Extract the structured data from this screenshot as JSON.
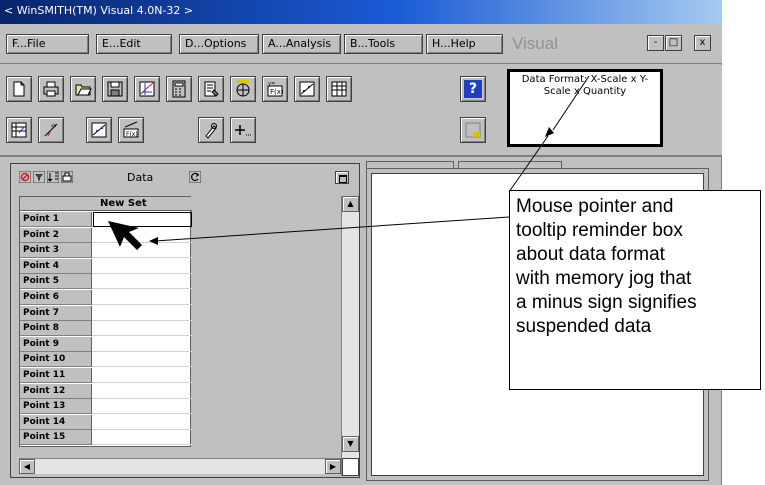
{
  "window": {
    "title": "< WinSMITH(TM) Visual 4.0N-32 >"
  },
  "menu": {
    "items": [
      {
        "label": "F...File"
      },
      {
        "label": "E...Edit"
      },
      {
        "label": "D...Options"
      },
      {
        "label": "A...Analysis"
      },
      {
        "label": "B...Tools"
      },
      {
        "label": "H...Help"
      }
    ],
    "brand": "Visual",
    "minimize": "-",
    "maximize": "□",
    "close": "x"
  },
  "toolbar": {
    "help_label": "?",
    "tooltip_text": "Data Format: X-Scale x Y-Scale x Quantity"
  },
  "data_panel": {
    "title": "Data",
    "column_header": "New Set",
    "rows": [
      {
        "label": "Point 1",
        "value": ""
      },
      {
        "label": "Point 2",
        "value": ""
      },
      {
        "label": "Point 3",
        "value": ""
      },
      {
        "label": "Point 4",
        "value": ""
      },
      {
        "label": "Point 5",
        "value": ""
      },
      {
        "label": "Point 6",
        "value": ""
      },
      {
        "label": "Point 7",
        "value": ""
      },
      {
        "label": "Point 8",
        "value": ""
      },
      {
        "label": "Point 9",
        "value": ""
      },
      {
        "label": "Point 10",
        "value": ""
      },
      {
        "label": "Point 11",
        "value": ""
      },
      {
        "label": "Point 12",
        "value": ""
      },
      {
        "label": "Point 13",
        "value": ""
      },
      {
        "label": "Point 14",
        "value": ""
      },
      {
        "label": "Point 15",
        "value": ""
      }
    ]
  },
  "callout": {
    "lines": [
      "Mouse pointer and",
      "tooltip reminder box",
      "about data format",
      "with memory jog that",
      "a minus sign signifies",
      "suspended data"
    ]
  },
  "colors": {
    "title_bar": "#08246b",
    "chrome": "#c0c0c0",
    "help_blue": "#2040c0"
  }
}
